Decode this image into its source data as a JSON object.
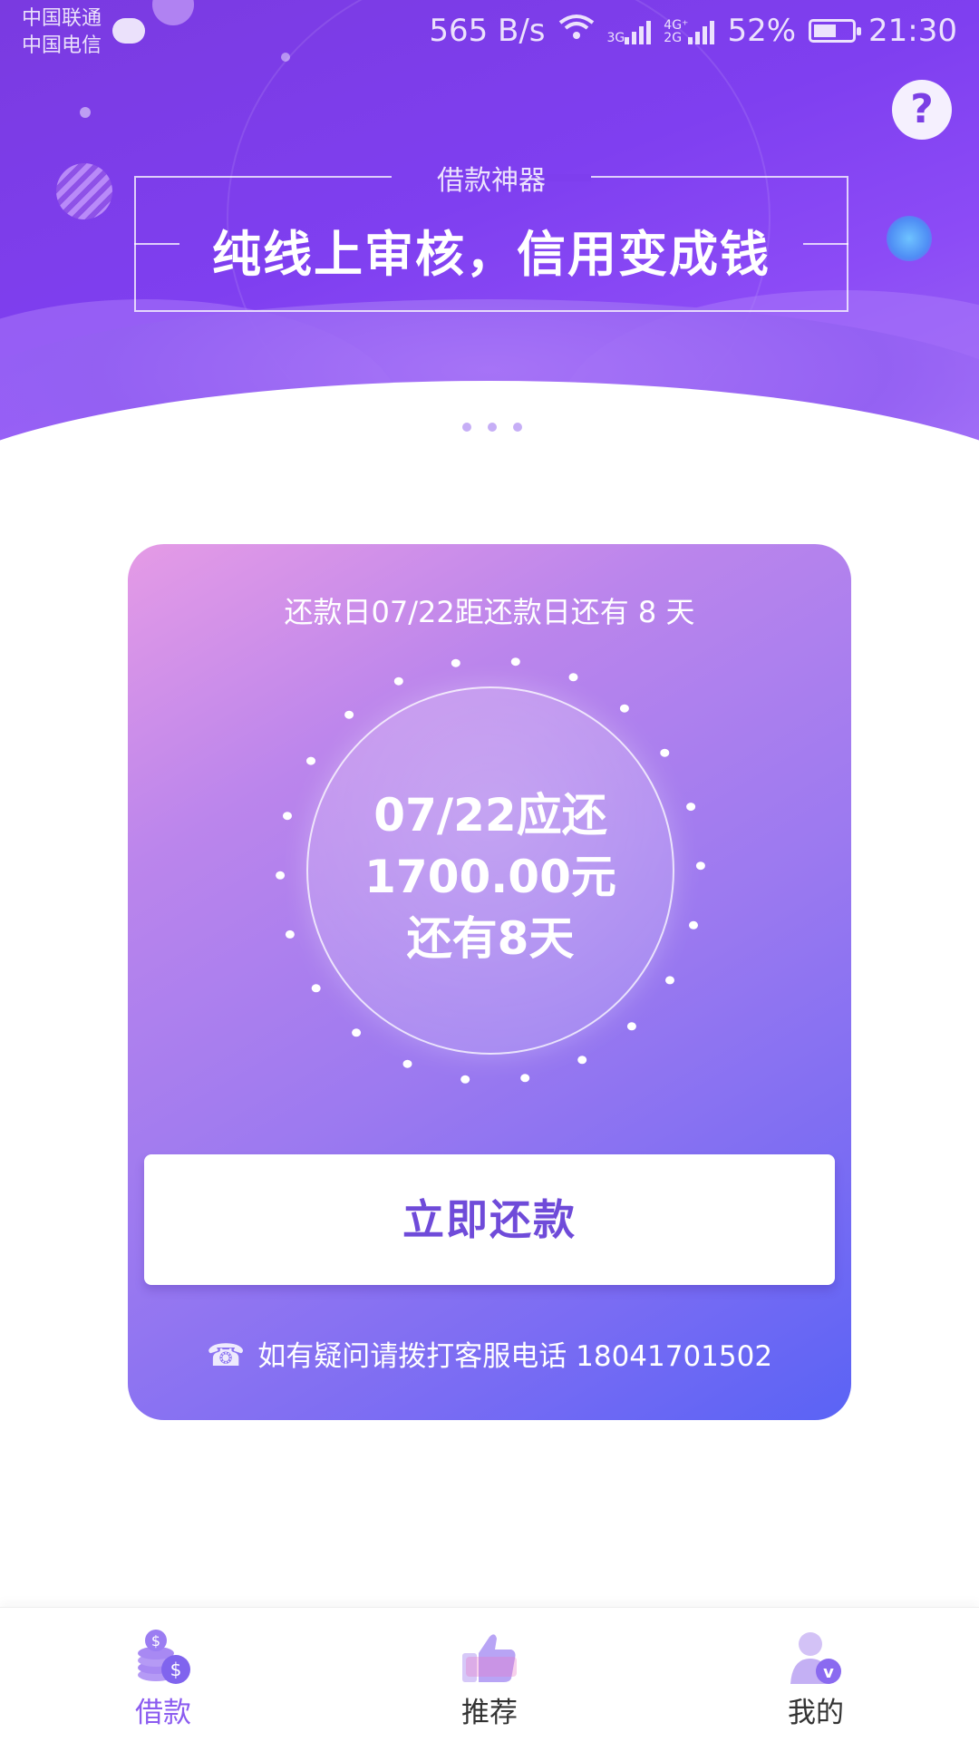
{
  "status_bar": {
    "carrier_1": "中国联通",
    "carrier_2": "中国电信",
    "net_speed": "565 B/s",
    "net_type_1": "3G",
    "net_type_2a": "4G⁺",
    "net_type_2b": "2G",
    "battery": "52%",
    "time": "21:30"
  },
  "header": {
    "help_label": "?"
  },
  "banner": {
    "subtitle": "借款神器",
    "title": "纯线上审核，信用变成钱"
  },
  "repay_card": {
    "due_notice": "还款日07/22距还款日还有 8 天",
    "amount_line1": "07/22应还",
    "amount_line2": "1700.00元",
    "amount_line3": "还有8天",
    "pay_button": "立即还款",
    "hotline": "如有疑问请拨打客服电话 18041701502"
  },
  "bottom_nav": {
    "items": [
      {
        "label": "借款",
        "icon": "coins-icon",
        "active": true
      },
      {
        "label": "推荐",
        "icon": "thumbs-up-icon",
        "active": false
      },
      {
        "label": "我的",
        "icon": "user-vip-icon",
        "active": false
      }
    ]
  },
  "colors": {
    "banner_primary": "#7f3ff0",
    "card_start": "#e59be6",
    "card_end": "#5a63f5",
    "accent": "#8b5cf0",
    "button_text": "#6f4bd9"
  }
}
